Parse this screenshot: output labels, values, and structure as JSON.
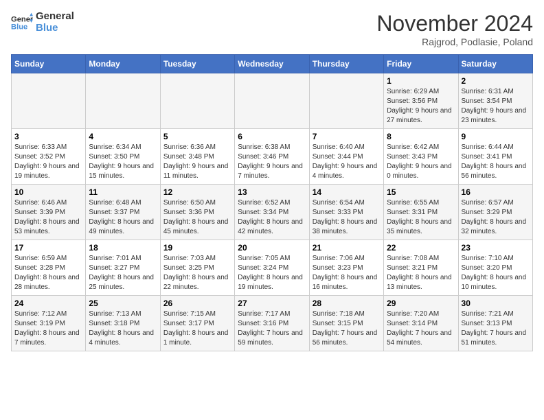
{
  "header": {
    "logo_line1": "General",
    "logo_line2": "Blue",
    "month": "November 2024",
    "location": "Rajgrod, Podlasie, Poland"
  },
  "weekdays": [
    "Sunday",
    "Monday",
    "Tuesday",
    "Wednesday",
    "Thursday",
    "Friday",
    "Saturday"
  ],
  "weeks": [
    [
      {
        "day": "",
        "info": ""
      },
      {
        "day": "",
        "info": ""
      },
      {
        "day": "",
        "info": ""
      },
      {
        "day": "",
        "info": ""
      },
      {
        "day": "",
        "info": ""
      },
      {
        "day": "1",
        "info": "Sunrise: 6:29 AM\nSunset: 3:56 PM\nDaylight: 9 hours and 27 minutes."
      },
      {
        "day": "2",
        "info": "Sunrise: 6:31 AM\nSunset: 3:54 PM\nDaylight: 9 hours and 23 minutes."
      }
    ],
    [
      {
        "day": "3",
        "info": "Sunrise: 6:33 AM\nSunset: 3:52 PM\nDaylight: 9 hours and 19 minutes."
      },
      {
        "day": "4",
        "info": "Sunrise: 6:34 AM\nSunset: 3:50 PM\nDaylight: 9 hours and 15 minutes."
      },
      {
        "day": "5",
        "info": "Sunrise: 6:36 AM\nSunset: 3:48 PM\nDaylight: 9 hours and 11 minutes."
      },
      {
        "day": "6",
        "info": "Sunrise: 6:38 AM\nSunset: 3:46 PM\nDaylight: 9 hours and 7 minutes."
      },
      {
        "day": "7",
        "info": "Sunrise: 6:40 AM\nSunset: 3:44 PM\nDaylight: 9 hours and 4 minutes."
      },
      {
        "day": "8",
        "info": "Sunrise: 6:42 AM\nSunset: 3:43 PM\nDaylight: 9 hours and 0 minutes."
      },
      {
        "day": "9",
        "info": "Sunrise: 6:44 AM\nSunset: 3:41 PM\nDaylight: 8 hours and 56 minutes."
      }
    ],
    [
      {
        "day": "10",
        "info": "Sunrise: 6:46 AM\nSunset: 3:39 PM\nDaylight: 8 hours and 53 minutes."
      },
      {
        "day": "11",
        "info": "Sunrise: 6:48 AM\nSunset: 3:37 PM\nDaylight: 8 hours and 49 minutes."
      },
      {
        "day": "12",
        "info": "Sunrise: 6:50 AM\nSunset: 3:36 PM\nDaylight: 8 hours and 45 minutes."
      },
      {
        "day": "13",
        "info": "Sunrise: 6:52 AM\nSunset: 3:34 PM\nDaylight: 8 hours and 42 minutes."
      },
      {
        "day": "14",
        "info": "Sunrise: 6:54 AM\nSunset: 3:33 PM\nDaylight: 8 hours and 38 minutes."
      },
      {
        "day": "15",
        "info": "Sunrise: 6:55 AM\nSunset: 3:31 PM\nDaylight: 8 hours and 35 minutes."
      },
      {
        "day": "16",
        "info": "Sunrise: 6:57 AM\nSunset: 3:29 PM\nDaylight: 8 hours and 32 minutes."
      }
    ],
    [
      {
        "day": "17",
        "info": "Sunrise: 6:59 AM\nSunset: 3:28 PM\nDaylight: 8 hours and 28 minutes."
      },
      {
        "day": "18",
        "info": "Sunrise: 7:01 AM\nSunset: 3:27 PM\nDaylight: 8 hours and 25 minutes."
      },
      {
        "day": "19",
        "info": "Sunrise: 7:03 AM\nSunset: 3:25 PM\nDaylight: 8 hours and 22 minutes."
      },
      {
        "day": "20",
        "info": "Sunrise: 7:05 AM\nSunset: 3:24 PM\nDaylight: 8 hours and 19 minutes."
      },
      {
        "day": "21",
        "info": "Sunrise: 7:06 AM\nSunset: 3:23 PM\nDaylight: 8 hours and 16 minutes."
      },
      {
        "day": "22",
        "info": "Sunrise: 7:08 AM\nSunset: 3:21 PM\nDaylight: 8 hours and 13 minutes."
      },
      {
        "day": "23",
        "info": "Sunrise: 7:10 AM\nSunset: 3:20 PM\nDaylight: 8 hours and 10 minutes."
      }
    ],
    [
      {
        "day": "24",
        "info": "Sunrise: 7:12 AM\nSunset: 3:19 PM\nDaylight: 8 hours and 7 minutes."
      },
      {
        "day": "25",
        "info": "Sunrise: 7:13 AM\nSunset: 3:18 PM\nDaylight: 8 hours and 4 minutes."
      },
      {
        "day": "26",
        "info": "Sunrise: 7:15 AM\nSunset: 3:17 PM\nDaylight: 8 hours and 1 minute."
      },
      {
        "day": "27",
        "info": "Sunrise: 7:17 AM\nSunset: 3:16 PM\nDaylight: 7 hours and 59 minutes."
      },
      {
        "day": "28",
        "info": "Sunrise: 7:18 AM\nSunset: 3:15 PM\nDaylight: 7 hours and 56 minutes."
      },
      {
        "day": "29",
        "info": "Sunrise: 7:20 AM\nSunset: 3:14 PM\nDaylight: 7 hours and 54 minutes."
      },
      {
        "day": "30",
        "info": "Sunrise: 7:21 AM\nSunset: 3:13 PM\nDaylight: 7 hours and 51 minutes."
      }
    ]
  ]
}
